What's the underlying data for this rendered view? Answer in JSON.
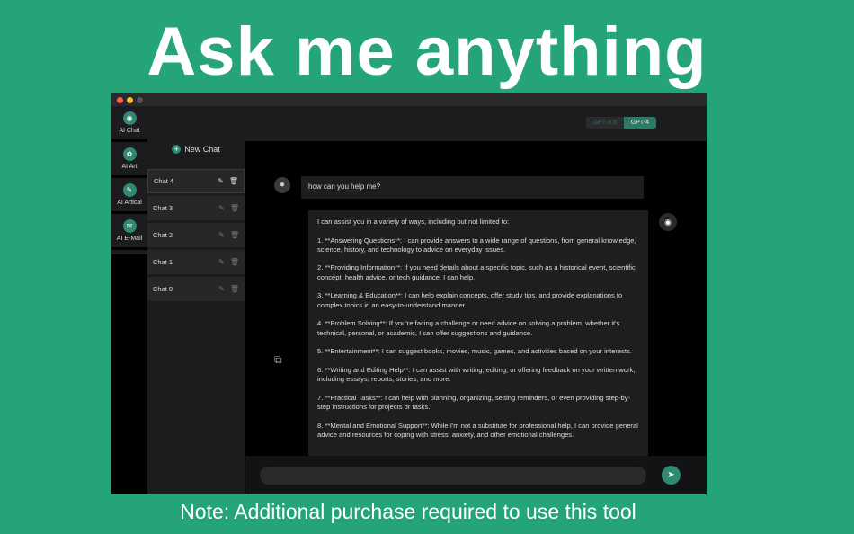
{
  "headline": "Ask me anything",
  "note": "Note: Additional purchase required to use this tool",
  "model_toggle": {
    "options": [
      "GPT-3.5",
      "GPT-4"
    ],
    "selected": "GPT-4"
  },
  "rail": [
    {
      "label": "AI Chat",
      "icon": "chat-bot-icon"
    },
    {
      "label": "AI Art",
      "icon": "palette-icon"
    },
    {
      "label": "AI Artical",
      "icon": "document-icon"
    },
    {
      "label": "AI E-Mail",
      "icon": "envelope-icon"
    }
  ],
  "new_chat": "New Chat",
  "chats": [
    "Chat 4",
    "Chat 3",
    "Chat 2",
    "Chat 1",
    "Chat 0"
  ],
  "active_chat": "Chat 4",
  "user_message": "how can you help me?",
  "assistant_message": [
    "I can assist you in a variety of ways, including but not limited to:",
    "1. **Answering Questions**: I can provide answers to a wide range of questions, from general knowledge, science, history, and technology to advice on everyday issues.",
    "2. **Providing Information**: If you need details about a specific topic, such as a historical event, scientific concept, health advice, or tech guidance, I can help.",
    "3. **Learning & Education**: I can help explain concepts, offer study tips, and provide explanations to complex topics in an easy-to-understand manner.",
    "4. **Problem Solving**: If you're facing a challenge or need advice on solving a problem, whether it's technical, personal, or academic, I can offer suggestions and guidance.",
    "5. **Entertainment**: I can suggest books, movies, music, games, and activities based on your interests.",
    "6. **Writing and Editing Help**: I can assist with writing, editing, or offering feedback on your written work, including essays, reports, stories, and more.",
    "7. **Practical Tasks**: I can help with planning, organizing, setting reminders, or even providing step-by-step instructions for projects or tasks.",
    "8. **Mental and Emotional Support**: While I'm not a substitute for professional help, I can provide general advice and resources for coping with stress, anxiety, and other emotional challenges."
  ],
  "input": {
    "value": "",
    "placeholder": ""
  },
  "colors": {
    "background": "#25a47a",
    "accent": "#2f8a72"
  }
}
